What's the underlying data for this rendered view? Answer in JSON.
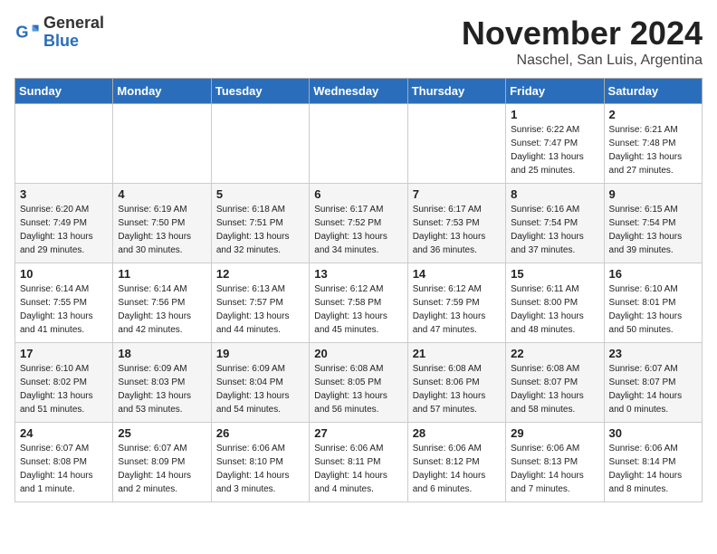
{
  "header": {
    "logo_general": "General",
    "logo_blue": "Blue",
    "month_title": "November 2024",
    "subtitle": "Naschel, San Luis, Argentina"
  },
  "weekdays": [
    "Sunday",
    "Monday",
    "Tuesday",
    "Wednesday",
    "Thursday",
    "Friday",
    "Saturday"
  ],
  "weeks": [
    [
      {
        "day": "",
        "info": ""
      },
      {
        "day": "",
        "info": ""
      },
      {
        "day": "",
        "info": ""
      },
      {
        "day": "",
        "info": ""
      },
      {
        "day": "",
        "info": ""
      },
      {
        "day": "1",
        "info": "Sunrise: 6:22 AM\nSunset: 7:47 PM\nDaylight: 13 hours\nand 25 minutes."
      },
      {
        "day": "2",
        "info": "Sunrise: 6:21 AM\nSunset: 7:48 PM\nDaylight: 13 hours\nand 27 minutes."
      }
    ],
    [
      {
        "day": "3",
        "info": "Sunrise: 6:20 AM\nSunset: 7:49 PM\nDaylight: 13 hours\nand 29 minutes."
      },
      {
        "day": "4",
        "info": "Sunrise: 6:19 AM\nSunset: 7:50 PM\nDaylight: 13 hours\nand 30 minutes."
      },
      {
        "day": "5",
        "info": "Sunrise: 6:18 AM\nSunset: 7:51 PM\nDaylight: 13 hours\nand 32 minutes."
      },
      {
        "day": "6",
        "info": "Sunrise: 6:17 AM\nSunset: 7:52 PM\nDaylight: 13 hours\nand 34 minutes."
      },
      {
        "day": "7",
        "info": "Sunrise: 6:17 AM\nSunset: 7:53 PM\nDaylight: 13 hours\nand 36 minutes."
      },
      {
        "day": "8",
        "info": "Sunrise: 6:16 AM\nSunset: 7:54 PM\nDaylight: 13 hours\nand 37 minutes."
      },
      {
        "day": "9",
        "info": "Sunrise: 6:15 AM\nSunset: 7:54 PM\nDaylight: 13 hours\nand 39 minutes."
      }
    ],
    [
      {
        "day": "10",
        "info": "Sunrise: 6:14 AM\nSunset: 7:55 PM\nDaylight: 13 hours\nand 41 minutes."
      },
      {
        "day": "11",
        "info": "Sunrise: 6:14 AM\nSunset: 7:56 PM\nDaylight: 13 hours\nand 42 minutes."
      },
      {
        "day": "12",
        "info": "Sunrise: 6:13 AM\nSunset: 7:57 PM\nDaylight: 13 hours\nand 44 minutes."
      },
      {
        "day": "13",
        "info": "Sunrise: 6:12 AM\nSunset: 7:58 PM\nDaylight: 13 hours\nand 45 minutes."
      },
      {
        "day": "14",
        "info": "Sunrise: 6:12 AM\nSunset: 7:59 PM\nDaylight: 13 hours\nand 47 minutes."
      },
      {
        "day": "15",
        "info": "Sunrise: 6:11 AM\nSunset: 8:00 PM\nDaylight: 13 hours\nand 48 minutes."
      },
      {
        "day": "16",
        "info": "Sunrise: 6:10 AM\nSunset: 8:01 PM\nDaylight: 13 hours\nand 50 minutes."
      }
    ],
    [
      {
        "day": "17",
        "info": "Sunrise: 6:10 AM\nSunset: 8:02 PM\nDaylight: 13 hours\nand 51 minutes."
      },
      {
        "day": "18",
        "info": "Sunrise: 6:09 AM\nSunset: 8:03 PM\nDaylight: 13 hours\nand 53 minutes."
      },
      {
        "day": "19",
        "info": "Sunrise: 6:09 AM\nSunset: 8:04 PM\nDaylight: 13 hours\nand 54 minutes."
      },
      {
        "day": "20",
        "info": "Sunrise: 6:08 AM\nSunset: 8:05 PM\nDaylight: 13 hours\nand 56 minutes."
      },
      {
        "day": "21",
        "info": "Sunrise: 6:08 AM\nSunset: 8:06 PM\nDaylight: 13 hours\nand 57 minutes."
      },
      {
        "day": "22",
        "info": "Sunrise: 6:08 AM\nSunset: 8:07 PM\nDaylight: 13 hours\nand 58 minutes."
      },
      {
        "day": "23",
        "info": "Sunrise: 6:07 AM\nSunset: 8:07 PM\nDaylight: 14 hours\nand 0 minutes."
      }
    ],
    [
      {
        "day": "24",
        "info": "Sunrise: 6:07 AM\nSunset: 8:08 PM\nDaylight: 14 hours\nand 1 minute."
      },
      {
        "day": "25",
        "info": "Sunrise: 6:07 AM\nSunset: 8:09 PM\nDaylight: 14 hours\nand 2 minutes."
      },
      {
        "day": "26",
        "info": "Sunrise: 6:06 AM\nSunset: 8:10 PM\nDaylight: 14 hours\nand 3 minutes."
      },
      {
        "day": "27",
        "info": "Sunrise: 6:06 AM\nSunset: 8:11 PM\nDaylight: 14 hours\nand 4 minutes."
      },
      {
        "day": "28",
        "info": "Sunrise: 6:06 AM\nSunset: 8:12 PM\nDaylight: 14 hours\nand 6 minutes."
      },
      {
        "day": "29",
        "info": "Sunrise: 6:06 AM\nSunset: 8:13 PM\nDaylight: 14 hours\nand 7 minutes."
      },
      {
        "day": "30",
        "info": "Sunrise: 6:06 AM\nSunset: 8:14 PM\nDaylight: 14 hours\nand 8 minutes."
      }
    ]
  ]
}
